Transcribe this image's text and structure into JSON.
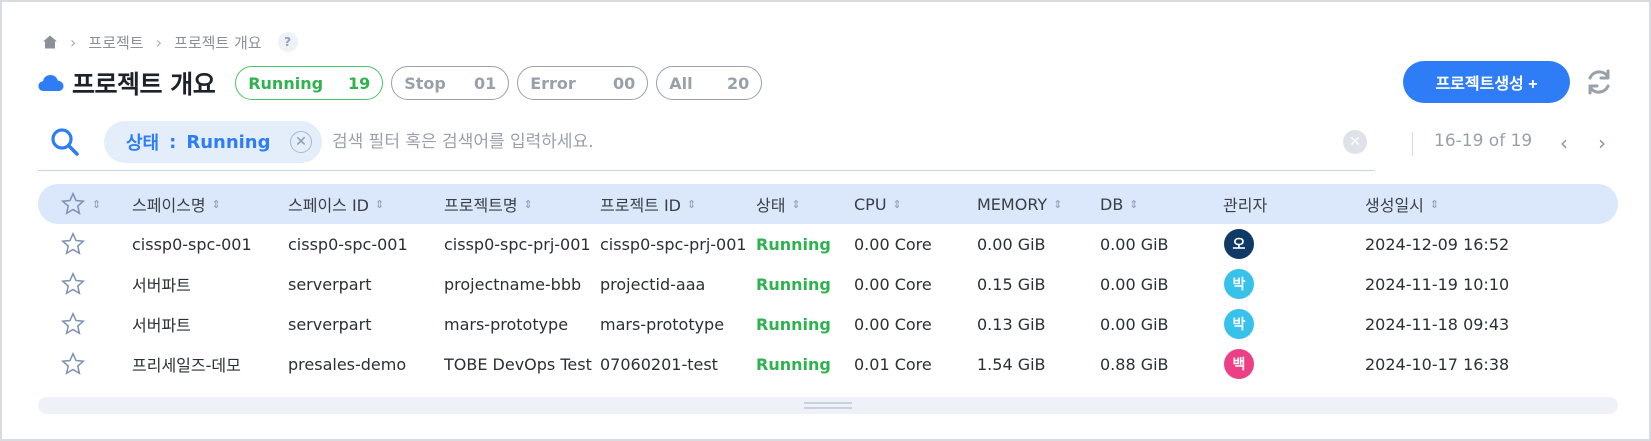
{
  "breadcrumb": {
    "item1": "프로젝트",
    "item2": "프로젝트 개요",
    "help": "?"
  },
  "header": {
    "title": "프로젝트 개요",
    "chips": [
      {
        "label": "Running",
        "count": "19"
      },
      {
        "label": "Stop",
        "count": "01"
      },
      {
        "label": "Error",
        "count": "00"
      },
      {
        "label": "All",
        "count": "20"
      }
    ],
    "create_label": "프로젝트생성 +"
  },
  "search": {
    "filter_key": "상태",
    "filter_sep": ":",
    "filter_value": "Running",
    "placeholder": "검색 필터 혹은 검색어를 입력하세요."
  },
  "pager": {
    "range": "16-19 of 19"
  },
  "table": {
    "columns": [
      "스페이스명",
      "스페이스 ID",
      "프로젝트명",
      "프로젝트 ID",
      "상태",
      "CPU",
      "MEMORY",
      "DB",
      "관리자",
      "생성일시"
    ],
    "rows": [
      {
        "space": "cissp0-spc-001",
        "space_id": "cissp0-spc-001",
        "project": "cissp0-spc-prj-001",
        "project_id": "cissp0-spc-prj-001",
        "status": "Running",
        "cpu": "0.00 Core",
        "memory": "0.00 GiB",
        "db": "0.00 GiB",
        "admin": "오",
        "admin_color": "#0f3a66",
        "created": "2024-12-09 16:52"
      },
      {
        "space": "서버파트",
        "space_id": "serverpart",
        "project": "projectname-bbb",
        "project_id": "projectid-aaa",
        "status": "Running",
        "cpu": "0.00 Core",
        "memory": "0.15 GiB",
        "db": "0.00 GiB",
        "admin": "박",
        "admin_color": "#36c2ea",
        "created": "2024-11-19 10:10"
      },
      {
        "space": "서버파트",
        "space_id": "serverpart",
        "project": "mars-prototype",
        "project_id": "mars-prototype",
        "status": "Running",
        "cpu": "0.00 Core",
        "memory": "0.13 GiB",
        "db": "0.00 GiB",
        "admin": "박",
        "admin_color": "#36c2ea",
        "created": "2024-11-18 09:43"
      },
      {
        "space": "프리세일즈-데모",
        "space_id": "presales-demo",
        "project": "TOBE DevOps Test",
        "project_id": "07060201-test",
        "status": "Running",
        "cpu": "0.01 Core",
        "memory": "1.54 GiB",
        "db": "0.88 GiB",
        "admin": "백",
        "admin_color": "#ec3f86",
        "created": "2024-10-17 16:38"
      }
    ]
  },
  "colors": {
    "accent": "#2f7df6",
    "running": "#2fb24f",
    "header_bg": "#dbe7fa"
  }
}
